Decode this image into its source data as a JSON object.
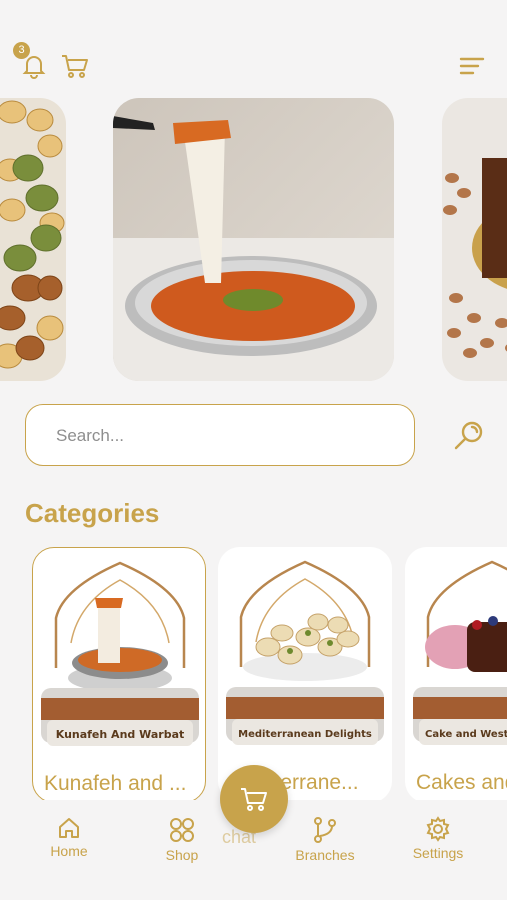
{
  "header": {
    "notifications_count": "3",
    "icons": [
      "bell-icon",
      "cart-icon",
      "menu-icon"
    ]
  },
  "carousel": {
    "slides": [
      {
        "id": "maamoul-tray"
      },
      {
        "id": "kunafeh-cheese-pull"
      },
      {
        "id": "chocolate-cake-nuts"
      }
    ]
  },
  "search": {
    "placeholder": "Search..."
  },
  "categories": {
    "title": "Categories",
    "items": [
      {
        "name": "Kunafeh and ...",
        "plate_label": "Kunafeh And Warbat"
      },
      {
        "name": "Mediterrane...",
        "plate_label": "Mediterranean Delights"
      },
      {
        "name": "Cakes and",
        "plate_label": "Cake and Wester"
      }
    ]
  },
  "bottom_nav": {
    "items": [
      {
        "label": "Home",
        "icon": "home-icon"
      },
      {
        "label": "Shop",
        "icon": "grid-icon"
      },
      {
        "label": "Branches",
        "icon": "branch-icon"
      },
      {
        "label": "Settings",
        "icon": "gear-icon"
      }
    ],
    "fab_icon": "cart-icon",
    "fab_ghost_label": "chat"
  },
  "colors": {
    "accent": "#c8a34b",
    "background": "#f5f4f4",
    "card": "#ffffff"
  }
}
